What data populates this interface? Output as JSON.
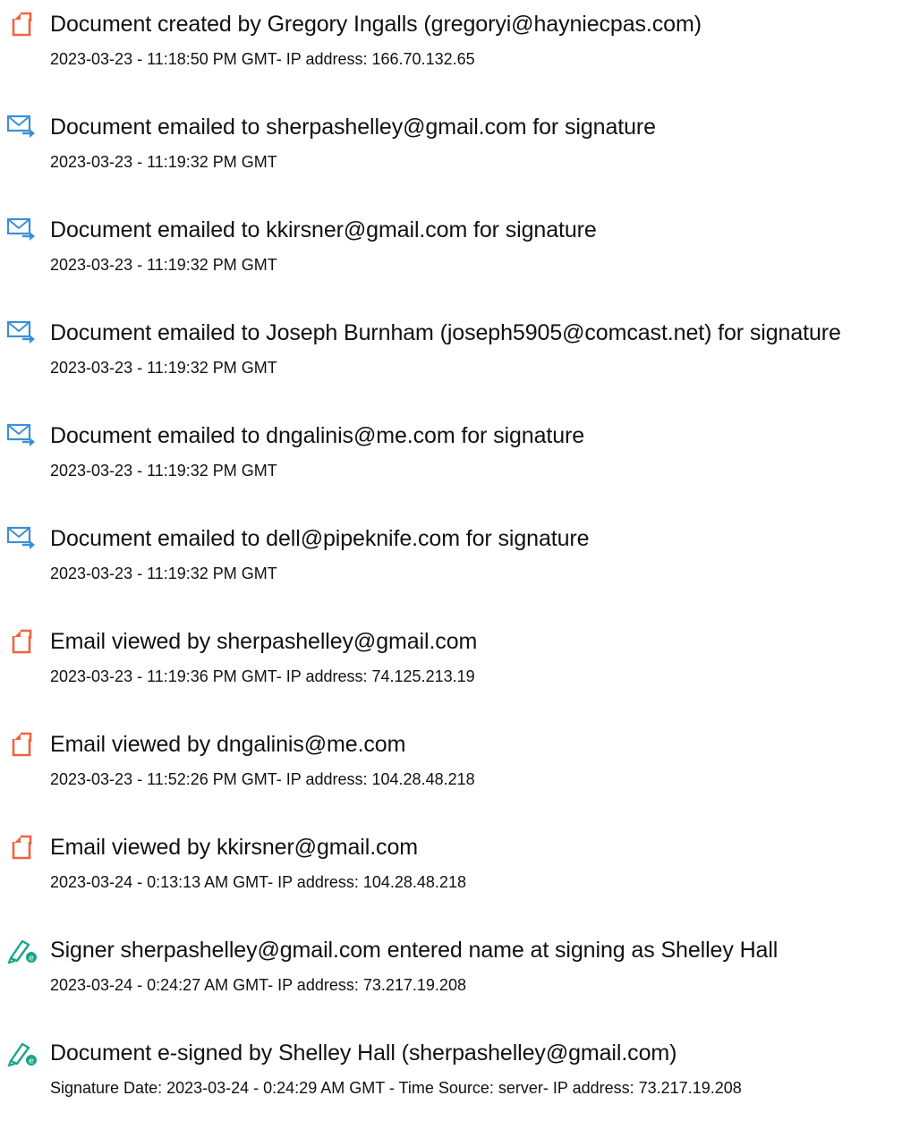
{
  "events": [
    {
      "icon": "document-created-icon",
      "title": "Document created by Gregory Ingalls (gregoryi@hayniecpas.com)",
      "detail": "2023-03-23 - 11:18:50 PM GMT- IP address: 166.70.132.65"
    },
    {
      "icon": "email-sent-icon",
      "title": "Document emailed to sherpashelley@gmail.com for signature",
      "detail": "2023-03-23 - 11:19:32 PM GMT"
    },
    {
      "icon": "email-sent-icon",
      "title": "Document emailed to kkirsner@gmail.com for signature",
      "detail": "2023-03-23 - 11:19:32 PM GMT"
    },
    {
      "icon": "email-sent-icon",
      "title": "Document emailed to Joseph Burnham (joseph5905@comcast.net) for signature",
      "detail": "2023-03-23 - 11:19:32 PM GMT"
    },
    {
      "icon": "email-sent-icon",
      "title": "Document emailed to dngalinis@me.com for signature",
      "detail": "2023-03-23 - 11:19:32 PM GMT"
    },
    {
      "icon": "email-sent-icon",
      "title": "Document emailed to dell@pipeknife.com for signature",
      "detail": "2023-03-23 - 11:19:32 PM GMT"
    },
    {
      "icon": "email-viewed-icon",
      "title": "Email viewed by sherpashelley@gmail.com",
      "detail": "2023-03-23 - 11:19:36 PM GMT- IP address: 74.125.213.19"
    },
    {
      "icon": "email-viewed-icon",
      "title": "Email viewed by dngalinis@me.com",
      "detail": "2023-03-23 - 11:52:26 PM GMT- IP address: 104.28.48.218"
    },
    {
      "icon": "email-viewed-icon",
      "title": "Email viewed by kkirsner@gmail.com",
      "detail": "2023-03-24 - 0:13:13 AM GMT- IP address: 104.28.48.218"
    },
    {
      "icon": "signer-name-entered-icon",
      "title": "Signer sherpashelley@gmail.com entered name at signing as Shelley Hall",
      "detail": "2023-03-24 - 0:24:27 AM GMT- IP address: 73.217.19.208"
    },
    {
      "icon": "e-signed-icon",
      "title": "Document e-signed by Shelley Hall (sherpashelley@gmail.com)",
      "detail": "Signature Date: 2023-03-24 - 0:24:29 AM GMT - Time Source: server- IP address: 73.217.19.208"
    }
  ],
  "colors": {
    "document_icon": "#f0643c",
    "email_icon": "#3a8fd8",
    "sign_icon": "#1aa58a",
    "text": "#111111"
  }
}
